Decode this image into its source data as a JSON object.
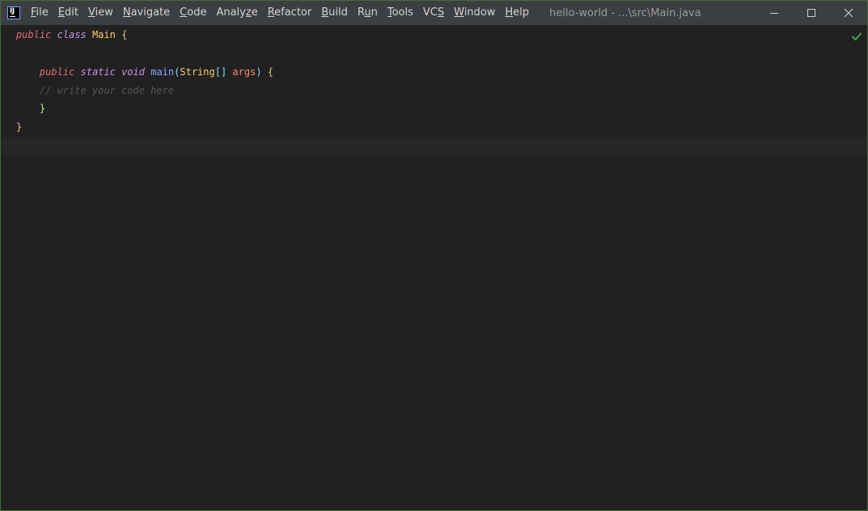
{
  "titlebar": {
    "menu": [
      {
        "mnemonic": "F",
        "rest": "ile"
      },
      {
        "mnemonic": "E",
        "rest": "dit"
      },
      {
        "mnemonic": "V",
        "rest": "iew"
      },
      {
        "mnemonic": "N",
        "rest": "avigate"
      },
      {
        "mnemonic": "C",
        "rest": "ode"
      },
      {
        "pre": "Analy",
        "mnemonic": "z",
        "rest": "e"
      },
      {
        "mnemonic": "R",
        "rest": "efactor"
      },
      {
        "mnemonic": "B",
        "rest": "uild"
      },
      {
        "pre": "R",
        "mnemonic": "u",
        "rest": "n"
      },
      {
        "mnemonic": "T",
        "rest": "ools"
      },
      {
        "pre": "VC",
        "mnemonic": "S",
        "rest": ""
      },
      {
        "mnemonic": "W",
        "rest": "indow"
      },
      {
        "mnemonic": "H",
        "rest": "elp"
      }
    ],
    "window_title": "hello-world - ...\\src\\Main.java"
  },
  "icons": {
    "app_logo": "intellij-idea-logo-icon",
    "minimize": "minimize-icon",
    "maximize": "maximize-icon",
    "close": "close-icon",
    "inspection": "checkmark-icon"
  },
  "editor": {
    "line1": {
      "kw1": "public",
      "kw2": "class",
      "name": "Main",
      "brace": "{"
    },
    "line3": {
      "kw1": "public",
      "kw2": "static",
      "kw3": "void",
      "fn": "main",
      "open": "(",
      "type": "String",
      "arr": "[]",
      "param": "args",
      "close": ")",
      "brace": "{"
    },
    "line4": {
      "comment": "// write your code here"
    },
    "line5": {
      "brace": "}"
    },
    "line6": {
      "brace": "}"
    }
  },
  "colors": {
    "editor_bg": "#212121",
    "titlebar_bg": "#3c3f41",
    "window_border": "#3f6b32",
    "inspection_ok": "#499c54"
  }
}
